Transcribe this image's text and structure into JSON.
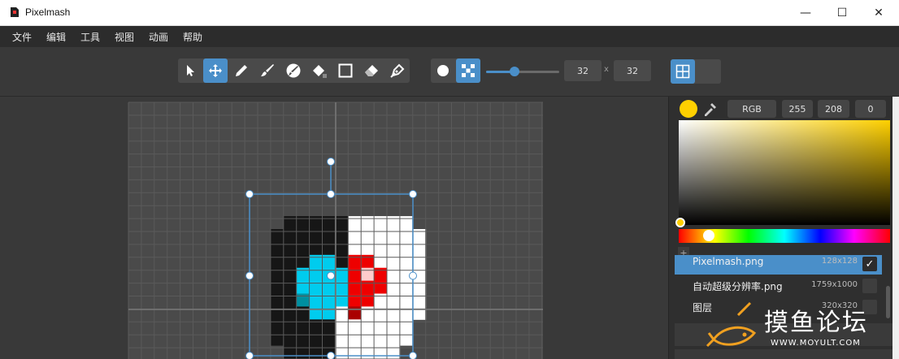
{
  "window": {
    "title": "Pixelmash",
    "minimize": "—",
    "maximize": "☐",
    "close": "✕"
  },
  "menu": [
    "文件",
    "编辑",
    "工具",
    "视图",
    "动画",
    "帮助"
  ],
  "toolbar": {
    "tools": [
      {
        "name": "select-tool",
        "icon": "arrow-icon",
        "active": false
      },
      {
        "name": "move-tool",
        "icon": "move-arrows-icon",
        "active": true
      },
      {
        "name": "pencil-tool",
        "icon": "pencil-icon",
        "active": false
      },
      {
        "name": "brush-tool",
        "icon": "brush-icon",
        "active": false
      },
      {
        "name": "shape-brush-tool",
        "icon": "brush-circle-icon",
        "active": false
      },
      {
        "name": "fill-tool",
        "icon": "fill-bucket-icon",
        "active": false
      },
      {
        "name": "rectangle-tool",
        "icon": "rectangle-icon",
        "active": false
      },
      {
        "name": "eraser-tool",
        "icon": "eraser-icon",
        "active": false
      },
      {
        "name": "pen-tool",
        "icon": "pen-nib-icon",
        "active": false
      }
    ],
    "brush_shapes": [
      {
        "name": "round-brush",
        "icon": "circle-icon",
        "active": false
      },
      {
        "name": "dither-brush",
        "icon": "checker-icon",
        "active": true
      }
    ],
    "brush_size_fraction": 0.39,
    "width": "32",
    "height": "32",
    "size_separator": "x",
    "view_toggles": [
      {
        "name": "grid-toggle",
        "icon": "grid-icon",
        "active": true
      },
      {
        "name": "second-toggle",
        "icon": "blank-icon",
        "active": false
      }
    ]
  },
  "color_panel": {
    "current_color": "#ffd000",
    "mode": "RGB",
    "r": "255",
    "g": "208",
    "b": "0",
    "hue_fraction": 0.14,
    "add_label": "+"
  },
  "layers": [
    {
      "name": "Pixelmash.png",
      "size": "128x128",
      "checked": "✓",
      "selected": true
    },
    {
      "name": "自动超级分辨率.png",
      "size": "1759x1000",
      "checked": "",
      "selected": false
    },
    {
      "name": "图层",
      "size": "320x320",
      "checked": "",
      "selected": false
    }
  ],
  "watermark": {
    "text": "摸鱼论坛",
    "url": "WWW.MOYULT.COM"
  },
  "colors": {
    "accent": "#4a8fc9",
    "dark_pixel": "#1a1a1a",
    "cyan_pixel": "#00ccee",
    "red_pixel": "#ee0000"
  }
}
